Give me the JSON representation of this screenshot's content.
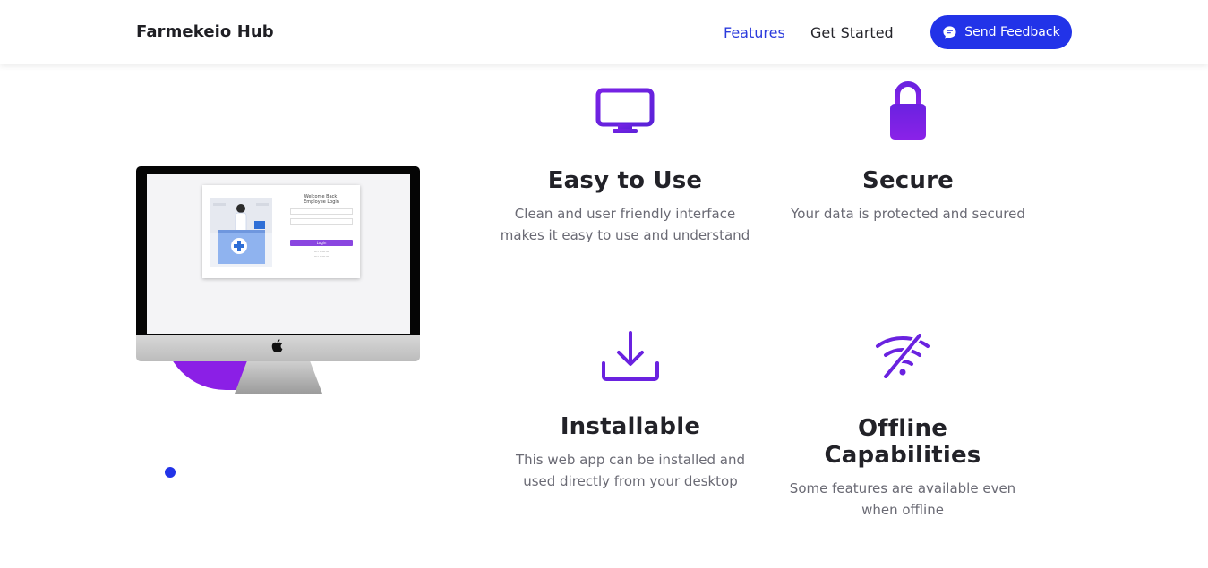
{
  "navbar": {
    "brand": "Farmekeio Hub",
    "links": [
      {
        "label": "Features",
        "active": true
      },
      {
        "label": "Get Started",
        "active": false
      }
    ],
    "feedback_button": "Send Feedback",
    "feedback_icon": "chat-bubble-icon"
  },
  "illustration": {
    "login_title_1": "Welcome Back!",
    "login_title_2": "Employee Login",
    "login_button": "Login"
  },
  "features": [
    {
      "icon": "monitor-icon",
      "title": "Easy to Use",
      "description": "Clean and user friendly interface makes it easy to use and understand"
    },
    {
      "icon": "lock-icon",
      "title": "Secure",
      "description": "Your data is protected and secured"
    },
    {
      "icon": "download-icon",
      "title": "Installable",
      "description": "This web app can be installed and used directly from your desktop"
    },
    {
      "icon": "wifi-off-icon",
      "title": "Offline Capabilities",
      "description": "Some features are available even when offline"
    }
  ],
  "colors": {
    "accent": "#2233e8",
    "icon_purple": "#6a22e0",
    "blob": "#8b1fe6"
  }
}
